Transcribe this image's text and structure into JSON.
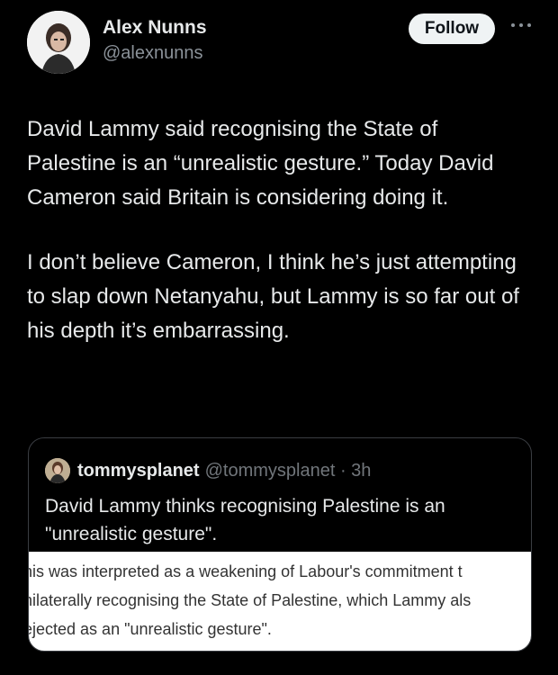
{
  "author": {
    "display_name": "Alex Nunns",
    "handle": "@alexnunns"
  },
  "follow_label": "Follow",
  "more_icon": "more-horizontal-icon",
  "tweet": {
    "paragraphs": [
      "David Lammy said recognising the State of Palestine is an “unrealistic gesture.” Today David Cameron said Britain is considering doing it.",
      "I don’t believe Cameron, I think he’s just attempting to slap down Netanyahu, but Lammy is so far out of his depth it’s embarrassing."
    ]
  },
  "quote": {
    "display_name": "tommysplanet",
    "handle_time": "@tommysplanet · 3h",
    "text": "David Lammy thinks recognising Palestine is an \"unrealistic gesture\".",
    "image_lines": [
      "his was interpreted as a weakening of Labour's commitment t",
      "nilaterally recognising the State of Palestine, which Lammy als",
      "ejected as an \"unrealistic gesture\"."
    ]
  },
  "colors": {
    "background": "#000000",
    "text": "#e7e9ea",
    "secondary_text": "#71767b",
    "follow_button_bg": "#eff3f4",
    "quote_border": "#3a3d42"
  }
}
